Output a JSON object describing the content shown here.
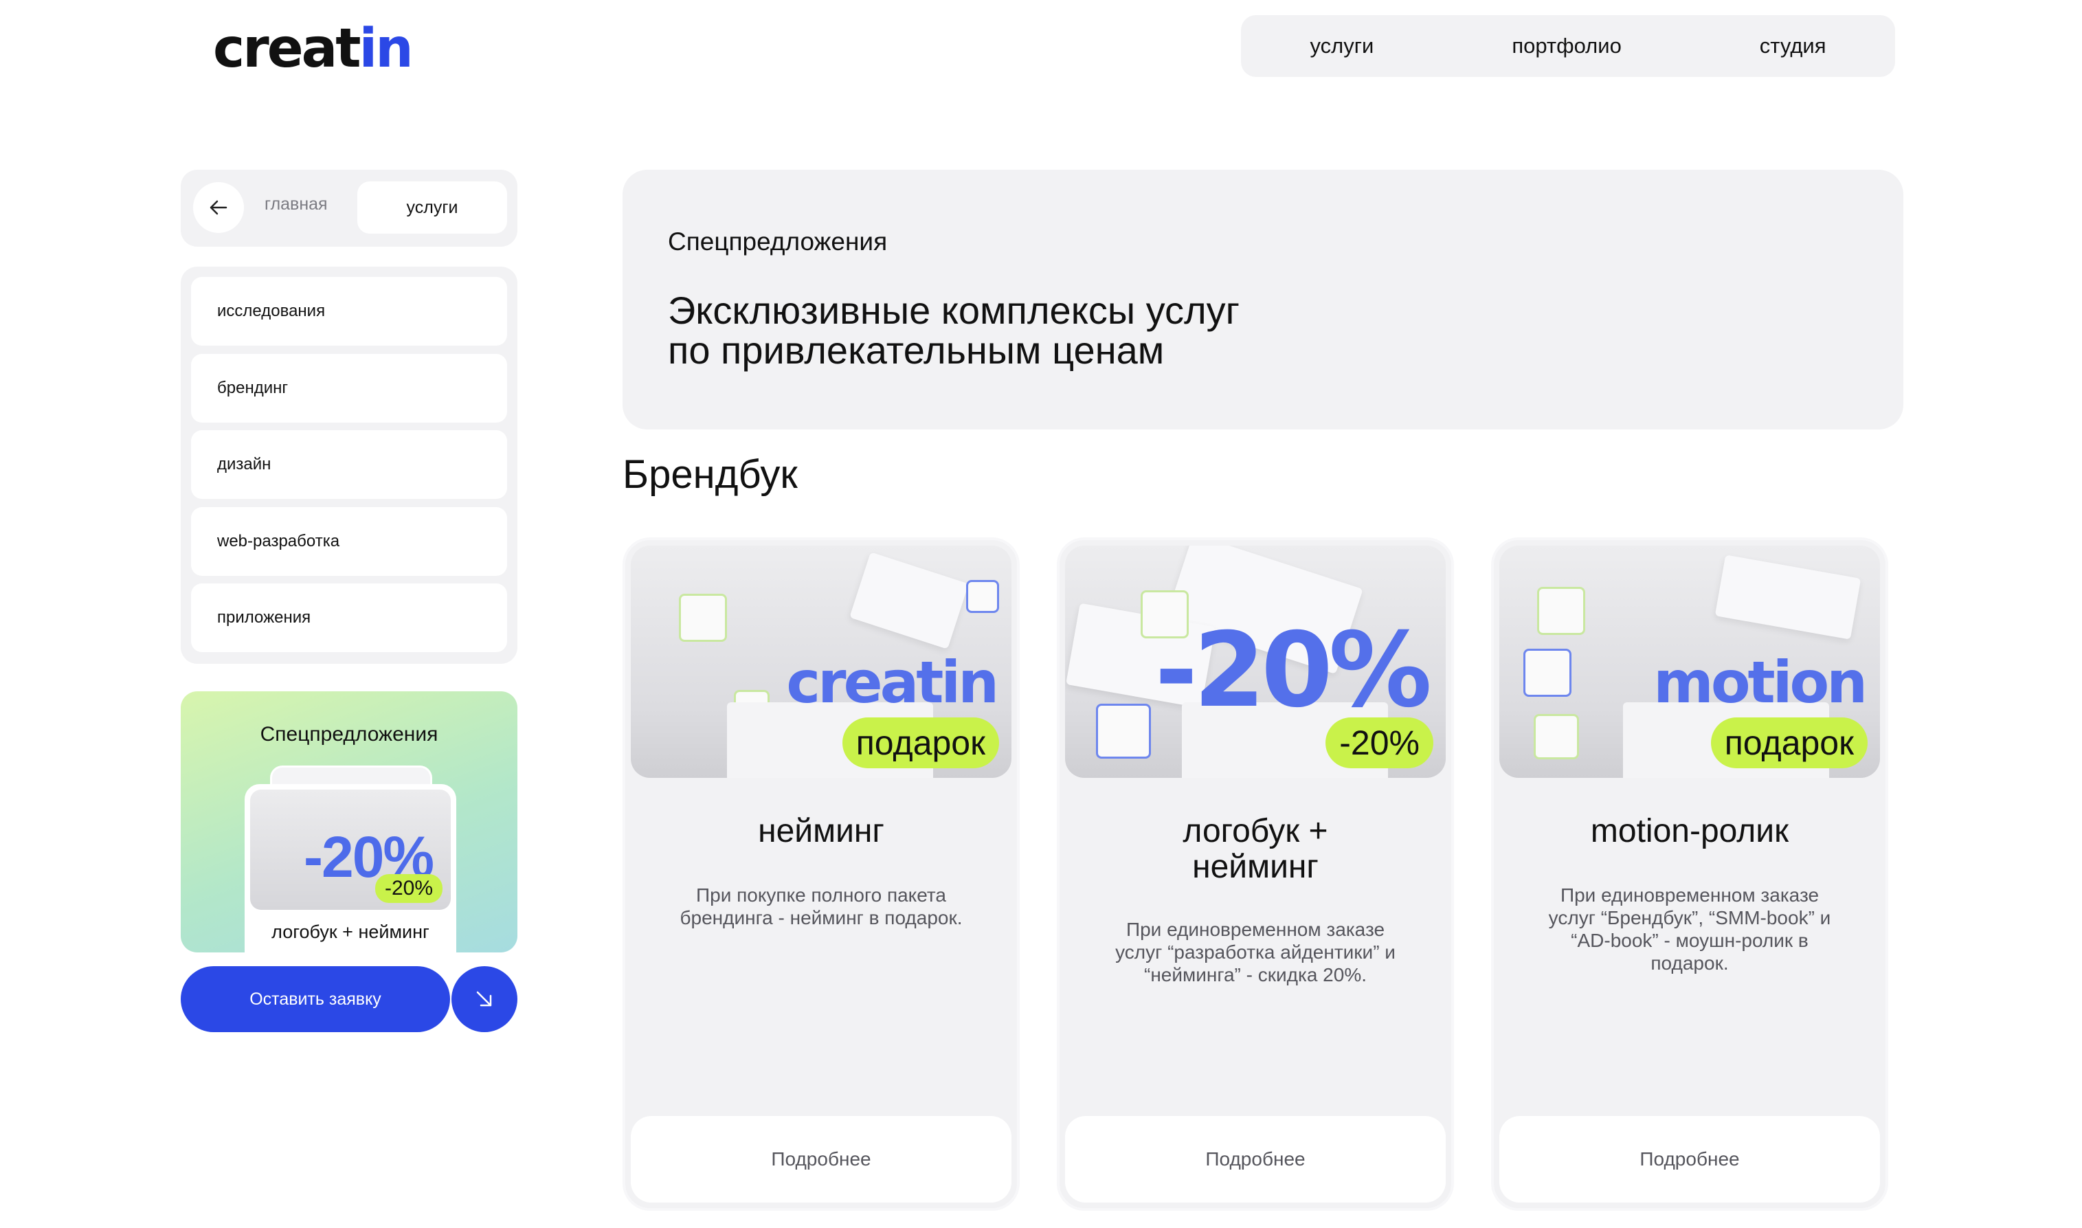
{
  "logo": {
    "text_main": "creat",
    "text_accent": "in"
  },
  "nav": [
    "услуги",
    "портфолио",
    "студия"
  ],
  "breadcrumb": {
    "back_icon": "arrow-left-icon",
    "home": "главная",
    "current": "услуги"
  },
  "categories": [
    "исследования",
    "брендинг",
    "дизайн",
    "web-разработка",
    "приложения"
  ],
  "promo": {
    "title": "Спецпредложения",
    "discount": "-20%",
    "badge": "-20%",
    "caption": "логобук + нейминг"
  },
  "cta": {
    "label": "Оставить заявку",
    "arrow_icon": "arrow-down-right-icon"
  },
  "hero": {
    "label": "Спецпредложения",
    "line1": "Эксклюзивные комплексы услуг",
    "line2": "по привлекательным ценам"
  },
  "section_title": "Брендбук",
  "offers": [
    {
      "image_word": "creatin",
      "badge": "подарок",
      "title_line1": "нейминг",
      "title_line2": "",
      "desc": "При покупке полного пакета брендинга - нейминг в подарок.",
      "more": "Подробнее"
    },
    {
      "image_word": "-20%",
      "badge": "-20%",
      "title_line1": "логобук +",
      "title_line2": "нейминг",
      "desc": "При единовременном заказе услуг “разработка айдентики” и “нейминга” - скидка 20%.",
      "more": "Подробнее"
    },
    {
      "image_word": "motion",
      "badge": "подарок",
      "title_line1": "motion-ролик",
      "title_line2": "",
      "desc": "При единовременном заказе услуг “Брендбук”, “SMM-book” и “AD-book” - моушн-ролик в подарок.",
      "more": "Подробнее"
    }
  ],
  "colors": {
    "accent": "#2b48e6",
    "lime": "#c9f24a",
    "panel": "#f2f2f4"
  }
}
